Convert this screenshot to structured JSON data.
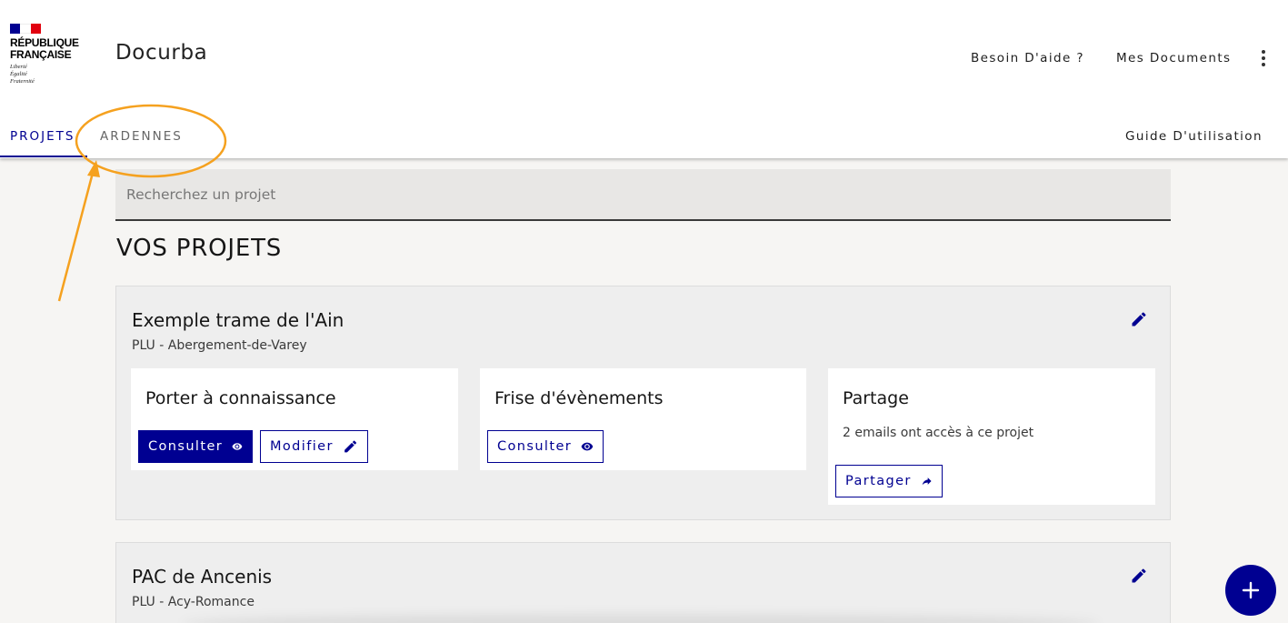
{
  "logo": {
    "line1": "RÉPUBLIQUE",
    "line2": "FRANÇAISE",
    "motto": [
      "Liberté",
      "Égalité",
      "Fraternité"
    ],
    "flag_colors": [
      "#000091",
      "#ffffff",
      "#e1000f"
    ]
  },
  "header": {
    "site_title": "Docurba",
    "help_link": "Besoin D'aide ?",
    "documents_link": "Mes Documents",
    "menu_icon": "more-vertical-icon"
  },
  "tabs": {
    "projets": "PROJETS",
    "ardennes": "ARDENNES",
    "guide": "Guide D'utilisation"
  },
  "search": {
    "placeholder": "Recherchez un projet",
    "value": ""
  },
  "section_title": "VOS PROJETS",
  "projects": [
    {
      "name": "Exemple trame de l'Ain",
      "subtitle": "PLU - Abergement-de-Varey",
      "tiles": {
        "pac": {
          "title": "Porter à connaissance",
          "consult": "Consulter",
          "modify": "Modifier"
        },
        "frise": {
          "title": "Frise d'évènements",
          "consult": "Consulter"
        },
        "partage": {
          "title": "Partage",
          "text": "2 emails ont accès à ce projet",
          "share": "Partager"
        }
      }
    },
    {
      "name": "PAC de Ancenis",
      "subtitle": "PLU - Acy-Romance"
    }
  ],
  "colors": {
    "primary": "#000091",
    "annotation": "#f5a11f",
    "background": "#f6f5f3",
    "card": "#eeeeee"
  }
}
